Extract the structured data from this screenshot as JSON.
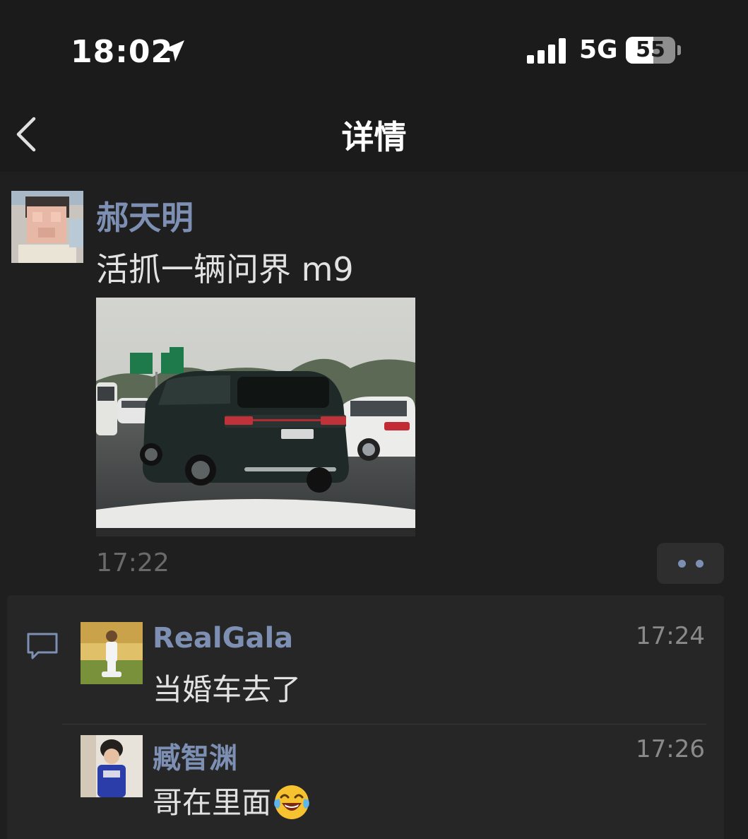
{
  "status_bar": {
    "time": "18:02",
    "network": "5G",
    "battery": "55",
    "battery_fraction": 0.55
  },
  "nav": {
    "title": "详情",
    "back_icon": "chevron-left-icon"
  },
  "post": {
    "author": "郝天明",
    "text": "活抓一辆问界 m9",
    "time": "17:22",
    "more_icon": "more-dots-icon"
  },
  "comments": [
    {
      "name": "RealGala",
      "time": "17:24",
      "text": "当婚车去了"
    },
    {
      "name": "臧智渊",
      "time": "17:26",
      "text": "哥在里面",
      "emoji": "laughing-tears-emoji"
    }
  ],
  "colors": {
    "background": "#1b1b1b",
    "link_name": "#7d90b4",
    "comment_panel": "#262626"
  }
}
